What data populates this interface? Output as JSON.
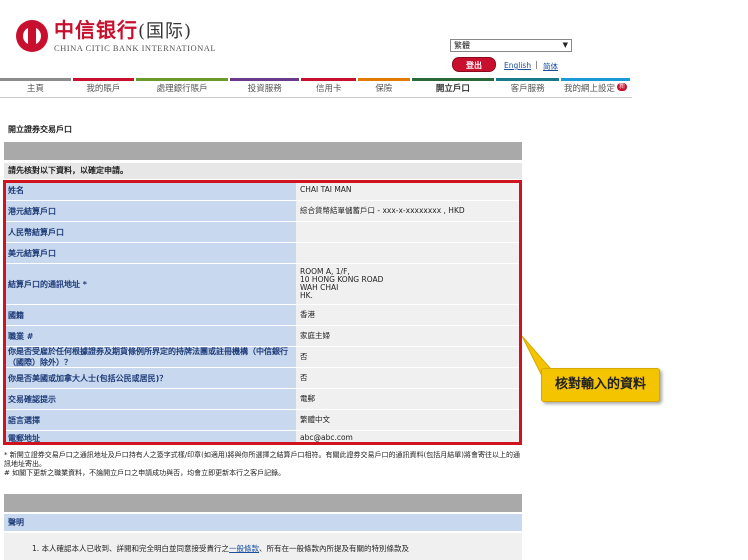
{
  "header": {
    "logo_cn": "中信银行",
    "logo_cn_suffix": "(国际)",
    "logo_en": "CHINA CITIC BANK INTERNATIONAL",
    "language_select": "繁體",
    "logout_label": "登出",
    "english_link": "English",
    "simplified_link": "简体"
  },
  "nav": {
    "items": [
      {
        "label": "主頁",
        "color": "#8c8c8c"
      },
      {
        "label": "我的賬戶",
        "color": "#c8102e"
      },
      {
        "label": "處理銀行賬戶",
        "color": "#6a9a2a"
      },
      {
        "label": "投資服務",
        "color": "#6a3a8a"
      },
      {
        "label": "信用卡",
        "color": "#c8102e"
      },
      {
        "label": "保險",
        "color": "#e07a00"
      },
      {
        "label": "開立戶口",
        "color": "#2a6a3a"
      },
      {
        "label": "客戶服務",
        "color": "#1a7a8a"
      },
      {
        "label": "我的網上設定",
        "color": "#1a9ad6",
        "badge": "新"
      }
    ]
  },
  "page": {
    "title": "開立證券交易戶口",
    "instruction": "請先核對以下資料，以確定申請。"
  },
  "form": {
    "rows": [
      {
        "label": "姓名",
        "value": "CHAI TAI MAN"
      },
      {
        "label": "港元結算戶口",
        "value": "綜合貨幣結單儲蓄戶口 - xxx-x-xxxxxxxx , HKD"
      },
      {
        "label": "人民幣結算戶口",
        "value": ""
      },
      {
        "label": "美元結算戶口",
        "value": ""
      },
      {
        "label": "結算戶口的通訊地址 *",
        "value": "ROOM A, 1/F,\n10 HONG KONG ROAD\nWAH CHAI\nHK."
      },
      {
        "label": "國籍",
        "value": "香港"
      },
      {
        "label": "職業 #",
        "value": "家庭主婦"
      },
      {
        "label": "你是否受雇於任何根據證券及期貨條例所界定的持牌法團或註冊機構（中信銀行（國際）除外）？",
        "value": "否"
      },
      {
        "label": "你是否美國或加拿大人士(包括公民或居民)？",
        "value": "否"
      },
      {
        "label": "交易確認提示",
        "value": "電郵"
      },
      {
        "label": "語言選擇",
        "value": "繁體中文"
      },
      {
        "label": "電郵地址",
        "value": "abc@abc.com"
      }
    ]
  },
  "footnotes": {
    "line1": "* 新開立證券交易戶口之通訊地址及戶口持有人之簽字式樣/印章(如適用)將與你所選擇之結算戶口相符。有關此證券交易戶口的通訊資料(包括月結單)將會寄往以上的通訊地址寄出。",
    "line2": "# 如閣下更新之職業資料，不論開立戶口之申請成功與否，均會立即更新本行之客戶記錄。"
  },
  "declaration": {
    "header": "聲明",
    "body_prefix": "1. 本人確認本人已收到、詳閱和完全明白並同意接受貴行之",
    "body_link": "一般條款",
    "body_suffix": "、所有在一般條款內所提及有關的特別條款及"
  },
  "callout": {
    "text": "核對輸入的資料"
  }
}
